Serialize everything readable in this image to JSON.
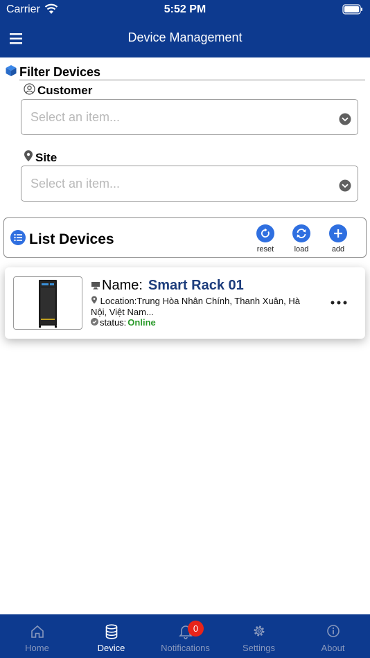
{
  "status_bar": {
    "carrier": "Carrier",
    "time": "5:52 PM"
  },
  "nav": {
    "title": "Device Management",
    "menu_icon": "hamburger-icon"
  },
  "filter": {
    "title": "Filter Devices",
    "customer_label": "Customer",
    "customer_placeholder": "Select an item...",
    "site_label": "Site",
    "site_placeholder": "Select an item..."
  },
  "list": {
    "title": "List Devices",
    "actions": [
      {
        "label": "reset",
        "icon": "reset-icon"
      },
      {
        "label": "load",
        "icon": "refresh-icon"
      },
      {
        "label": "add",
        "icon": "plus-icon"
      }
    ]
  },
  "devices": [
    {
      "name_label": "Name:",
      "name": "Smart Rack 01",
      "location": "Location:Trung Hòa Nhân Chính, Thanh Xuân, Hà Nội, Việt Nam...",
      "status_label": "status:",
      "status": "Online"
    }
  ],
  "tabs": [
    {
      "label": "Home",
      "icon": "home-icon",
      "active": false
    },
    {
      "label": "Device",
      "icon": "database-icon",
      "active": true
    },
    {
      "label": "Notifications",
      "icon": "bell-icon",
      "active": false,
      "badge": "0"
    },
    {
      "label": "Settings",
      "icon": "gear-icon",
      "active": false
    },
    {
      "label": "About",
      "icon": "info-icon",
      "active": false
    }
  ],
  "colors": {
    "header": "#0d3a8f",
    "accent": "#2f6fe0",
    "online": "#2a9a2a",
    "device_name": "#1d3d7c",
    "badge": "#e8241a"
  }
}
